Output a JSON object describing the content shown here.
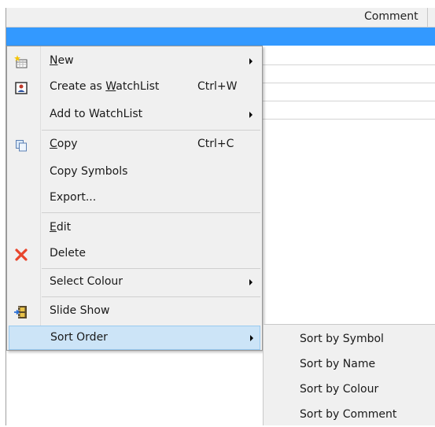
{
  "header": {
    "comment_column": "Comment"
  },
  "context_menu": {
    "items": [
      {
        "label_pre": "",
        "label_u": "N",
        "label_post": "ew",
        "shortcut": "",
        "submenu": true,
        "icon": "new-grid-icon"
      },
      {
        "label_pre": "Create as ",
        "label_u": "W",
        "label_post": "atchList",
        "shortcut": "Ctrl+W",
        "submenu": false,
        "icon": "watchlist-icon"
      },
      {
        "label_pre": "Add to WatchList",
        "label_u": "",
        "label_post": "",
        "shortcut": "",
        "submenu": true,
        "icon": ""
      },
      {
        "label_pre": "",
        "label_u": "C",
        "label_post": "opy",
        "shortcut": "Ctrl+C",
        "submenu": false,
        "icon": "copy-icon"
      },
      {
        "label_pre": "Copy Symbols",
        "label_u": "",
        "label_post": "",
        "shortcut": "",
        "submenu": false,
        "icon": ""
      },
      {
        "label_pre": "Export...",
        "label_u": "",
        "label_post": "",
        "shortcut": "",
        "submenu": false,
        "icon": ""
      },
      {
        "label_pre": "",
        "label_u": "E",
        "label_post": "dit",
        "shortcut": "",
        "submenu": false,
        "icon": ""
      },
      {
        "label_pre": "Delete",
        "label_u": "",
        "label_post": "",
        "shortcut": "",
        "submenu": false,
        "icon": "delete-x-icon"
      },
      {
        "label_pre": "Select Colour",
        "label_u": "",
        "label_post": "",
        "shortcut": "",
        "submenu": true,
        "icon": ""
      },
      {
        "label_pre": "Slide Show",
        "label_u": "",
        "label_post": "",
        "shortcut": "",
        "submenu": false,
        "icon": "film-icon"
      },
      {
        "label_pre": "Sort Order",
        "label_u": "",
        "label_post": "",
        "shortcut": "",
        "submenu": true,
        "icon": ""
      }
    ]
  },
  "sort_submenu": {
    "items": [
      "Sort by Symbol",
      "Sort by Name",
      "Sort by Colour",
      "Sort by Comment"
    ]
  },
  "colors": {
    "selection": "#3399ff",
    "menu_bg": "#f0f0f0",
    "highlight": "#cce4f7",
    "delete_red": "#e8452c"
  }
}
